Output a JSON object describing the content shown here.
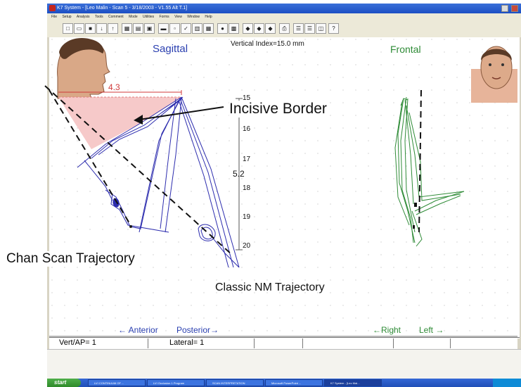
{
  "window": {
    "title": "K7 System - [Leo Malin - Scan 5 - 3/18/2003 - V1.55   Alt T.1]"
  },
  "menu": [
    "File",
    "Setup",
    "Analysis",
    "Tools",
    "Comment",
    "Mode",
    "Utilities",
    "Forms",
    "View",
    "Window",
    "Help"
  ],
  "views": {
    "sagittal_title": "Sagittal",
    "frontal_title": "Frontal",
    "vertical_index": "Vertical Index=15.0 mm",
    "horizontal_measure": "4.3",
    "vertical_measure": "5.2",
    "scale_ticks": [
      "15",
      "16",
      "17",
      "18",
      "19",
      "20"
    ]
  },
  "annotations": {
    "incisive": "Incisive Border",
    "chan": "Chan Scan Trajectory",
    "classic": "Classic NM Trajectory"
  },
  "axes": {
    "anterior": "← Anterior",
    "posterior": "Posterior→",
    "right": "←Right",
    "left": "Left →"
  },
  "status": {
    "vert_ap": "Vert/AP= 1",
    "lateral": "Lateral= 1"
  },
  "taskbar": {
    "start": "start",
    "items": [
      "LVI CONTINUUM OF ...",
      "LVI Occlusion 1 Program",
      "SCAN INTERPRETATION",
      "Microsoft PowerPoint ...",
      "K7 System - [Leo Mal..."
    ]
  },
  "colors": {
    "sagittal_trace": "#2c2cae",
    "frontal_trace": "#2e8b36",
    "view_title": "#2a3fb0",
    "frontal_title": "#2e8b36",
    "incisive_fill": "#f6c9c9",
    "measure_red": "#d03a3a"
  }
}
